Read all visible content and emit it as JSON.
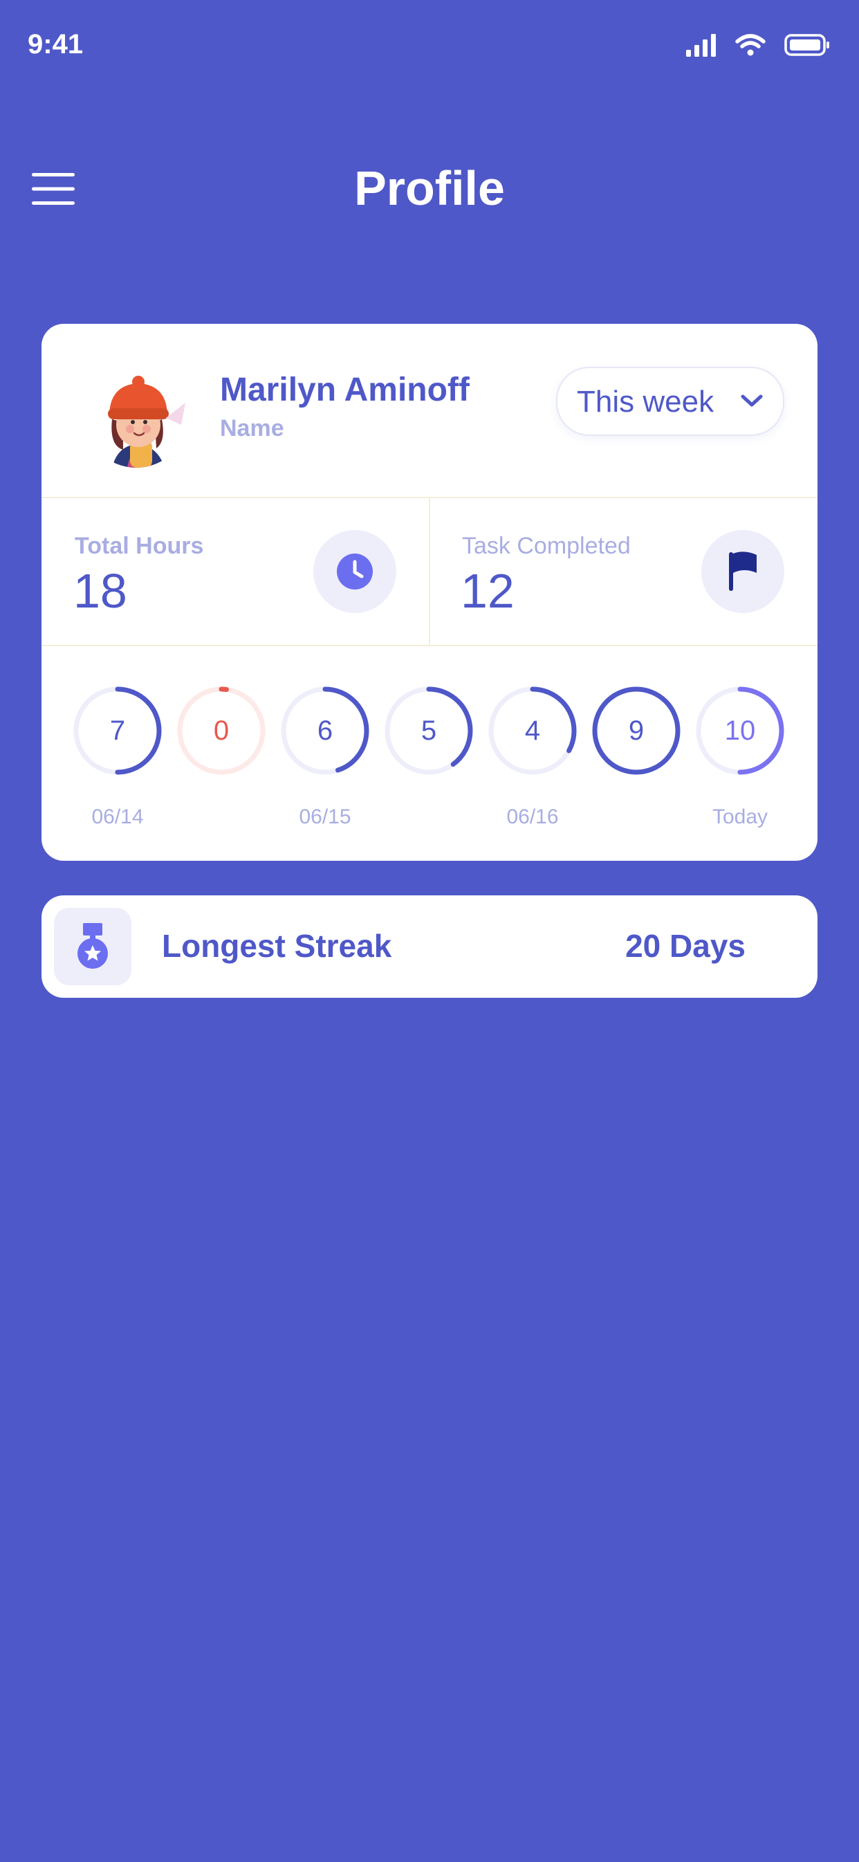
{
  "status_bar": {
    "time": "9:41",
    "icons": [
      "signal-icon",
      "wifi-icon",
      "battery-icon"
    ]
  },
  "header": {
    "title": "Profile",
    "menu_icon": "hamburger-menu-icon"
  },
  "profile": {
    "name": "Marilyn Aminoff",
    "name_caption": "Name",
    "range_selector": {
      "value": "This week",
      "icon": "chevron-down-icon"
    }
  },
  "stats": [
    {
      "label": "Total  Hours",
      "value": "18",
      "icon": "clock-icon"
    },
    {
      "label": "Task Completed",
      "value": "12",
      "icon": "flag-icon"
    }
  ],
  "daily_hours": [
    {
      "value": "7",
      "fraction": 0.5,
      "color": "#4f58c8"
    },
    {
      "value": "0",
      "fraction": 0.02,
      "color": "#e8584e"
    },
    {
      "value": "6",
      "fraction": 0.45,
      "color": "#4f58c8"
    },
    {
      "value": "5",
      "fraction": 0.4,
      "color": "#4f58c8"
    },
    {
      "value": "4",
      "fraction": 0.33,
      "color": "#4f58c8"
    },
    {
      "value": "9",
      "fraction": 1.0,
      "color": "#4f58c8"
    },
    {
      "value": "10",
      "fraction": 0.5,
      "color": "#7a72f0"
    }
  ],
  "date_labels": [
    "06/14",
    "06/15",
    "06/16",
    "Today"
  ],
  "streak": {
    "label": "Longest Streak",
    "value": "20 Days",
    "icon": "medal-icon"
  },
  "colors": {
    "background": "#4f58c8",
    "accent": "#4f58c8",
    "muted": "#a8ade2",
    "zero": "#e8584e",
    "today": "#7a72f0"
  }
}
